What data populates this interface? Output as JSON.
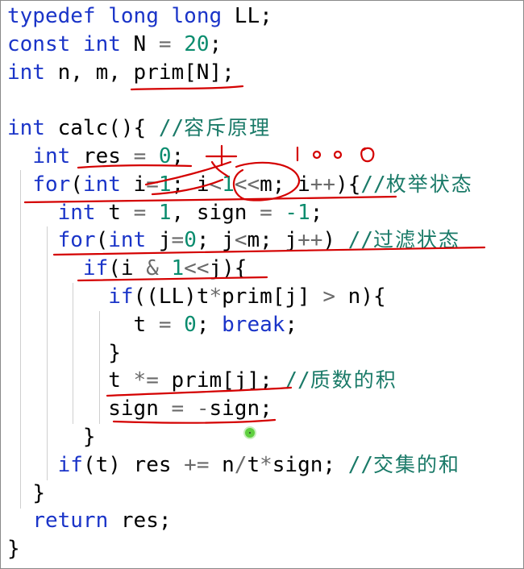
{
  "code": {
    "language": "C++",
    "lines": [
      {
        "indent": "",
        "tokens": [
          {
            "t": "typedef",
            "c": "kw"
          },
          {
            "t": " "
          },
          {
            "t": "long",
            "c": "kw"
          },
          {
            "t": " "
          },
          {
            "t": "long",
            "c": "kw"
          },
          {
            "t": " LL;"
          }
        ]
      },
      {
        "indent": "",
        "tokens": [
          {
            "t": "const",
            "c": "kw"
          },
          {
            "t": " "
          },
          {
            "t": "int",
            "c": "kw"
          },
          {
            "t": " N "
          },
          {
            "t": "=",
            "c": "op"
          },
          {
            "t": " "
          },
          {
            "t": "20",
            "c": "num"
          },
          {
            "t": ";"
          }
        ]
      },
      {
        "indent": "",
        "tokens": [
          {
            "t": "int",
            "c": "kw"
          },
          {
            "t": " n, m, prim[N];"
          }
        ]
      },
      {
        "indent": "",
        "tokens": []
      },
      {
        "indent": "",
        "tokens": [
          {
            "t": "int",
            "c": "kw"
          },
          {
            "t": " calc(){ "
          },
          {
            "t": "//",
            "c": "cm"
          },
          {
            "t": "容斥原理",
            "c": "cm cmz"
          }
        ]
      },
      {
        "indent": "  ",
        "tokens": [
          {
            "t": "int",
            "c": "kw"
          },
          {
            "t": " res "
          },
          {
            "t": "=",
            "c": "op"
          },
          {
            "t": " "
          },
          {
            "t": "0",
            "c": "num"
          },
          {
            "t": ";"
          }
        ]
      },
      {
        "indent": "  ",
        "tokens": [
          {
            "t": "for",
            "c": "kw"
          },
          {
            "t": "("
          },
          {
            "t": "int",
            "c": "kw"
          },
          {
            "t": " i"
          },
          {
            "t": "=",
            "c": "op"
          },
          {
            "t": "1",
            "c": "num"
          },
          {
            "t": "; i"
          },
          {
            "t": "<",
            "c": "op"
          },
          {
            "t": "1",
            "c": "num"
          },
          {
            "t": "<<",
            "c": "op"
          },
          {
            "t": "m; i"
          },
          {
            "t": "++",
            "c": "op"
          },
          {
            "t": "){"
          },
          {
            "t": "//",
            "c": "cm"
          },
          {
            "t": "枚举状态",
            "c": "cm cmz"
          }
        ]
      },
      {
        "indent": "    ",
        "tokens": [
          {
            "t": "int",
            "c": "kw"
          },
          {
            "t": " t "
          },
          {
            "t": "=",
            "c": "op"
          },
          {
            "t": " "
          },
          {
            "t": "1",
            "c": "num"
          },
          {
            "t": ", sign "
          },
          {
            "t": "=",
            "c": "op"
          },
          {
            "t": " "
          },
          {
            "t": "-1",
            "c": "num"
          },
          {
            "t": ";"
          }
        ]
      },
      {
        "indent": "    ",
        "tokens": [
          {
            "t": "for",
            "c": "kw"
          },
          {
            "t": "("
          },
          {
            "t": "int",
            "c": "kw"
          },
          {
            "t": " j"
          },
          {
            "t": "=",
            "c": "op"
          },
          {
            "t": "0",
            "c": "num"
          },
          {
            "t": "; j"
          },
          {
            "t": "<",
            "c": "op"
          },
          {
            "t": "m; j"
          },
          {
            "t": "++",
            "c": "op"
          },
          {
            "t": ") "
          },
          {
            "t": "//",
            "c": "cm"
          },
          {
            "t": "过滤状态",
            "c": "cm cmz"
          }
        ]
      },
      {
        "indent": "      ",
        "tokens": [
          {
            "t": "if",
            "c": "kw"
          },
          {
            "t": "(i "
          },
          {
            "t": "&",
            "c": "op"
          },
          {
            "t": " "
          },
          {
            "t": "1",
            "c": "num"
          },
          {
            "t": "<<",
            "c": "op"
          },
          {
            "t": "j){"
          }
        ]
      },
      {
        "indent": "        ",
        "tokens": [
          {
            "t": "if",
            "c": "kw"
          },
          {
            "t": "((LL)t"
          },
          {
            "t": "*",
            "c": "op"
          },
          {
            "t": "prim[j] "
          },
          {
            "t": ">",
            "c": "op"
          },
          {
            "t": " n){"
          }
        ]
      },
      {
        "indent": "          ",
        "tokens": [
          {
            "t": "t "
          },
          {
            "t": "=",
            "c": "op"
          },
          {
            "t": " "
          },
          {
            "t": "0",
            "c": "num"
          },
          {
            "t": "; "
          },
          {
            "t": "break",
            "c": "kw"
          },
          {
            "t": ";"
          }
        ]
      },
      {
        "indent": "        ",
        "tokens": [
          {
            "t": "}"
          }
        ]
      },
      {
        "indent": "        ",
        "tokens": [
          {
            "t": "t "
          },
          {
            "t": "*=",
            "c": "op"
          },
          {
            "t": " prim[j]; "
          },
          {
            "t": "//",
            "c": "cm"
          },
          {
            "t": "质数的积",
            "c": "cm cmz"
          }
        ]
      },
      {
        "indent": "        ",
        "tokens": [
          {
            "t": "sign "
          },
          {
            "t": "=",
            "c": "op"
          },
          {
            "t": " "
          },
          {
            "t": "-",
            "c": "op"
          },
          {
            "t": "sign;"
          }
        ]
      },
      {
        "indent": "      ",
        "tokens": [
          {
            "t": "}"
          }
        ]
      },
      {
        "indent": "    ",
        "tokens": [
          {
            "t": "if",
            "c": "kw"
          },
          {
            "t": "(t) res "
          },
          {
            "t": "+=",
            "c": "op"
          },
          {
            "t": " n"
          },
          {
            "t": "/",
            "c": "op"
          },
          {
            "t": "t"
          },
          {
            "t": "*",
            "c": "op"
          },
          {
            "t": "sign; "
          },
          {
            "t": "//",
            "c": "cm"
          },
          {
            "t": "交集的和",
            "c": "cm cmz"
          }
        ]
      },
      {
        "indent": "  ",
        "tokens": [
          {
            "t": "}"
          }
        ]
      },
      {
        "indent": "  ",
        "tokens": [
          {
            "t": "return",
            "c": "kw"
          },
          {
            "t": " res;"
          }
        ]
      },
      {
        "indent": "",
        "tokens": [
          {
            "t": "}"
          }
        ]
      }
    ]
  },
  "annotations": {
    "handwritten_note": "1000",
    "ink_color": "#d40000"
  },
  "colors": {
    "keyword": "#1a34c8",
    "number": "#0a8c6e",
    "comment": "#1a7a68",
    "operator": "#6a6a6a",
    "cursor": "#5fcf3f"
  }
}
